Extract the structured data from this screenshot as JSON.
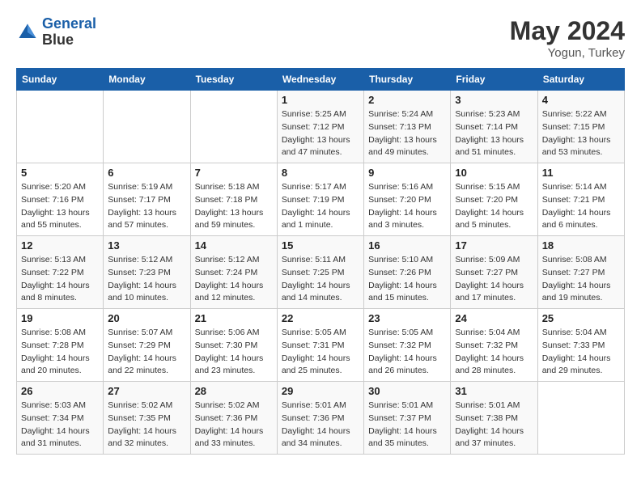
{
  "header": {
    "logo_line1": "General",
    "logo_line2": "Blue",
    "month_year": "May 2024",
    "location": "Yogun, Turkey"
  },
  "weekdays": [
    "Sunday",
    "Monday",
    "Tuesday",
    "Wednesday",
    "Thursday",
    "Friday",
    "Saturday"
  ],
  "weeks": [
    [
      {
        "day": "",
        "info": ""
      },
      {
        "day": "",
        "info": ""
      },
      {
        "day": "",
        "info": ""
      },
      {
        "day": "1",
        "info": "Sunrise: 5:25 AM\nSunset: 7:12 PM\nDaylight: 13 hours\nand 47 minutes."
      },
      {
        "day": "2",
        "info": "Sunrise: 5:24 AM\nSunset: 7:13 PM\nDaylight: 13 hours\nand 49 minutes."
      },
      {
        "day": "3",
        "info": "Sunrise: 5:23 AM\nSunset: 7:14 PM\nDaylight: 13 hours\nand 51 minutes."
      },
      {
        "day": "4",
        "info": "Sunrise: 5:22 AM\nSunset: 7:15 PM\nDaylight: 13 hours\nand 53 minutes."
      }
    ],
    [
      {
        "day": "5",
        "info": "Sunrise: 5:20 AM\nSunset: 7:16 PM\nDaylight: 13 hours\nand 55 minutes."
      },
      {
        "day": "6",
        "info": "Sunrise: 5:19 AM\nSunset: 7:17 PM\nDaylight: 13 hours\nand 57 minutes."
      },
      {
        "day": "7",
        "info": "Sunrise: 5:18 AM\nSunset: 7:18 PM\nDaylight: 13 hours\nand 59 minutes."
      },
      {
        "day": "8",
        "info": "Sunrise: 5:17 AM\nSunset: 7:19 PM\nDaylight: 14 hours\nand 1 minute."
      },
      {
        "day": "9",
        "info": "Sunrise: 5:16 AM\nSunset: 7:20 PM\nDaylight: 14 hours\nand 3 minutes."
      },
      {
        "day": "10",
        "info": "Sunrise: 5:15 AM\nSunset: 7:20 PM\nDaylight: 14 hours\nand 5 minutes."
      },
      {
        "day": "11",
        "info": "Sunrise: 5:14 AM\nSunset: 7:21 PM\nDaylight: 14 hours\nand 6 minutes."
      }
    ],
    [
      {
        "day": "12",
        "info": "Sunrise: 5:13 AM\nSunset: 7:22 PM\nDaylight: 14 hours\nand 8 minutes."
      },
      {
        "day": "13",
        "info": "Sunrise: 5:12 AM\nSunset: 7:23 PM\nDaylight: 14 hours\nand 10 minutes."
      },
      {
        "day": "14",
        "info": "Sunrise: 5:12 AM\nSunset: 7:24 PM\nDaylight: 14 hours\nand 12 minutes."
      },
      {
        "day": "15",
        "info": "Sunrise: 5:11 AM\nSunset: 7:25 PM\nDaylight: 14 hours\nand 14 minutes."
      },
      {
        "day": "16",
        "info": "Sunrise: 5:10 AM\nSunset: 7:26 PM\nDaylight: 14 hours\nand 15 minutes."
      },
      {
        "day": "17",
        "info": "Sunrise: 5:09 AM\nSunset: 7:27 PM\nDaylight: 14 hours\nand 17 minutes."
      },
      {
        "day": "18",
        "info": "Sunrise: 5:08 AM\nSunset: 7:27 PM\nDaylight: 14 hours\nand 19 minutes."
      }
    ],
    [
      {
        "day": "19",
        "info": "Sunrise: 5:08 AM\nSunset: 7:28 PM\nDaylight: 14 hours\nand 20 minutes."
      },
      {
        "day": "20",
        "info": "Sunrise: 5:07 AM\nSunset: 7:29 PM\nDaylight: 14 hours\nand 22 minutes."
      },
      {
        "day": "21",
        "info": "Sunrise: 5:06 AM\nSunset: 7:30 PM\nDaylight: 14 hours\nand 23 minutes."
      },
      {
        "day": "22",
        "info": "Sunrise: 5:05 AM\nSunset: 7:31 PM\nDaylight: 14 hours\nand 25 minutes."
      },
      {
        "day": "23",
        "info": "Sunrise: 5:05 AM\nSunset: 7:32 PM\nDaylight: 14 hours\nand 26 minutes."
      },
      {
        "day": "24",
        "info": "Sunrise: 5:04 AM\nSunset: 7:32 PM\nDaylight: 14 hours\nand 28 minutes."
      },
      {
        "day": "25",
        "info": "Sunrise: 5:04 AM\nSunset: 7:33 PM\nDaylight: 14 hours\nand 29 minutes."
      }
    ],
    [
      {
        "day": "26",
        "info": "Sunrise: 5:03 AM\nSunset: 7:34 PM\nDaylight: 14 hours\nand 31 minutes."
      },
      {
        "day": "27",
        "info": "Sunrise: 5:02 AM\nSunset: 7:35 PM\nDaylight: 14 hours\nand 32 minutes."
      },
      {
        "day": "28",
        "info": "Sunrise: 5:02 AM\nSunset: 7:36 PM\nDaylight: 14 hours\nand 33 minutes."
      },
      {
        "day": "29",
        "info": "Sunrise: 5:01 AM\nSunset: 7:36 PM\nDaylight: 14 hours\nand 34 minutes."
      },
      {
        "day": "30",
        "info": "Sunrise: 5:01 AM\nSunset: 7:37 PM\nDaylight: 14 hours\nand 35 minutes."
      },
      {
        "day": "31",
        "info": "Sunrise: 5:01 AM\nSunset: 7:38 PM\nDaylight: 14 hours\nand 37 minutes."
      },
      {
        "day": "",
        "info": ""
      }
    ]
  ]
}
